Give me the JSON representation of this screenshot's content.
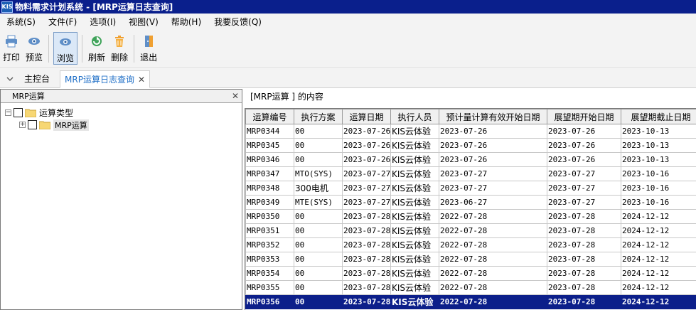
{
  "window": {
    "icon_text": "KIS",
    "title": "物料需求计划系统 - [MRP运算日志查询]"
  },
  "menu": [
    {
      "label": "系统(S)"
    },
    {
      "label": "文件(F)"
    },
    {
      "label": "选项(I)"
    },
    {
      "label": "视图(V)"
    },
    {
      "label": "帮助(H)"
    },
    {
      "label": "我要反馈(Q)"
    }
  ],
  "toolbar": {
    "print": "打印",
    "preview": "预览",
    "browse": "浏览",
    "refresh": "刷新",
    "delete": "删除",
    "exit": "退出"
  },
  "tabs": {
    "home": "主控台",
    "active": "MRP运算日志查询"
  },
  "left_panel": {
    "title": "MRP运算",
    "tree": {
      "root": "运算类型",
      "child": "MRP运算"
    }
  },
  "content_label": "[MRP运算 ] 的内容",
  "table": {
    "columns": [
      "运算编号",
      "执行方案",
      "运算日期",
      "执行人员",
      "预计量计算有效开始日期",
      "展望期开始日期",
      "展望期截止日期"
    ],
    "rows": [
      [
        "MRP0344",
        "00",
        "2023-07-26",
        "KIS云体验",
        "2023-07-26",
        "2023-07-26",
        "2023-10-13"
      ],
      [
        "MRP0345",
        "00",
        "2023-07-26",
        "KIS云体验",
        "2023-07-26",
        "2023-07-26",
        "2023-10-13"
      ],
      [
        "MRP0346",
        "00",
        "2023-07-26",
        "KIS云体验",
        "2023-07-26",
        "2023-07-26",
        "2023-10-13"
      ],
      [
        "MRP0347",
        "MTO(SYS)",
        "2023-07-27",
        "KIS云体验",
        "2023-07-27",
        "2023-07-27",
        "2023-10-16"
      ],
      [
        "MRP0348",
        "300电机",
        "2023-07-27",
        "KIS云体验",
        "2023-07-27",
        "2023-07-27",
        "2023-10-16"
      ],
      [
        "MRP0349",
        "MTE(SYS)",
        "2023-07-27",
        "KIS云体验",
        "2023-06-27",
        "2023-07-27",
        "2023-10-16"
      ],
      [
        "MRP0350",
        "00",
        "2023-07-28",
        "KIS云体验",
        "2022-07-28",
        "2023-07-28",
        "2024-12-12"
      ],
      [
        "MRP0351",
        "00",
        "2023-07-28",
        "KIS云体验",
        "2022-07-28",
        "2023-07-28",
        "2024-12-12"
      ],
      [
        "MRP0352",
        "00",
        "2023-07-28",
        "KIS云体验",
        "2022-07-28",
        "2023-07-28",
        "2024-12-12"
      ],
      [
        "MRP0353",
        "00",
        "2023-07-28",
        "KIS云体验",
        "2022-07-28",
        "2023-07-28",
        "2024-12-12"
      ],
      [
        "MRP0354",
        "00",
        "2023-07-28",
        "KIS云体验",
        "2022-07-28",
        "2023-07-28",
        "2024-12-12"
      ],
      [
        "MRP0355",
        "00",
        "2023-07-28",
        "KIS云体验",
        "2022-07-28",
        "2023-07-28",
        "2024-12-12"
      ],
      [
        "MRP0356",
        "00",
        "2023-07-28",
        "KIS云体验",
        "2022-07-28",
        "2023-07-28",
        "2024-12-12"
      ]
    ],
    "selected_row": 12
  }
}
